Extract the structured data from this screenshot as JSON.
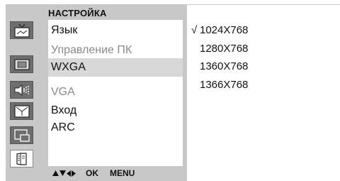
{
  "menu": {
    "title": "НАСТРОЙКА",
    "icons": [
      {
        "name": "tv-picture-icon",
        "active": false
      },
      {
        "name": "screen-icon",
        "active": false
      },
      {
        "name": "speaker-icon",
        "active": false
      },
      {
        "name": "clock-icon",
        "active": false
      },
      {
        "name": "pip-icon",
        "active": false
      },
      {
        "name": "setup-book-icon",
        "active": true
      }
    ],
    "items": [
      {
        "label": "Язык",
        "state": "normal"
      },
      {
        "label": "Управление ПК",
        "state": "disabled"
      },
      {
        "label": "WXGA",
        "state": "selected"
      },
      {
        "label": "VGA",
        "state": "disabled"
      },
      {
        "label": "Вход",
        "state": "normal"
      },
      {
        "label": "ARC",
        "state": "normal"
      }
    ],
    "hints": {
      "ok": "OK",
      "menu": "MENU"
    }
  },
  "resolutions": {
    "check_mark": "√",
    "options": [
      {
        "label": "1024X768",
        "checked": true
      },
      {
        "label": "1280X768",
        "checked": false
      },
      {
        "label": "1360X768",
        "checked": false
      },
      {
        "label": "1366X768",
        "checked": false
      }
    ]
  },
  "colors": {
    "osd_background": "#c8c8c8",
    "icon_background": "#6e6e6e",
    "selected_row": "#d8d8d8",
    "disabled_text": "#8a8a8a"
  }
}
